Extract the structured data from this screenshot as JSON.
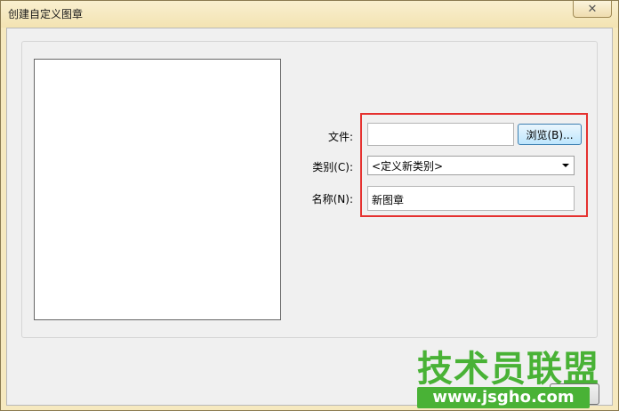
{
  "window": {
    "title": "创建自定义图章",
    "close_glyph": "✕"
  },
  "form": {
    "file_label": "文件:",
    "file_value": "",
    "browse_label": "浏览(B)...",
    "category_label": "类别(C):",
    "category_value": "<定义新类别>",
    "name_label": "名称(N):",
    "name_value": "新图章"
  },
  "watermark": {
    "main": "技术员联盟",
    "url": "www.jsgho.com"
  },
  "colors": {
    "highlight": "#e5312f",
    "watermark": "#49b236"
  }
}
